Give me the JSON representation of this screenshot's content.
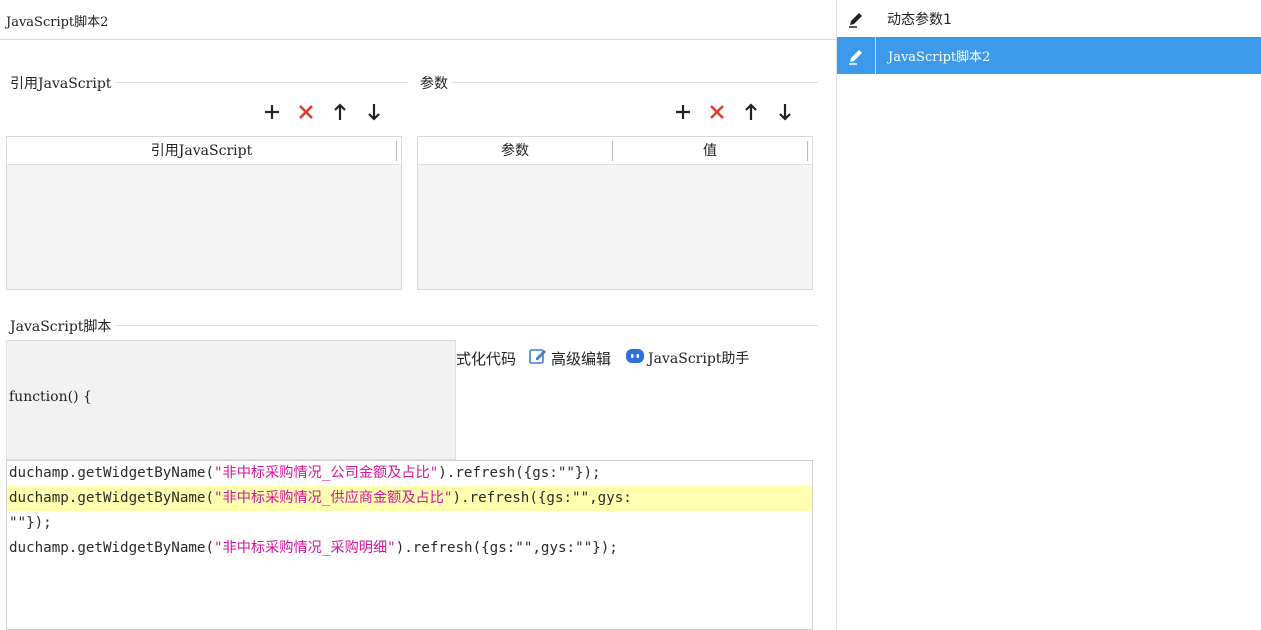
{
  "window": {
    "title": "JavaScript脚本2"
  },
  "ref_js": {
    "group_label": "引用JavaScript",
    "column_header": "引用JavaScript"
  },
  "params": {
    "group_label": "参数",
    "columns": [
      "参数",
      "值"
    ]
  },
  "toolbar_icons": [
    "add-icon",
    "delete-icon",
    "move-up-icon",
    "move-down-icon"
  ],
  "script": {
    "group_label": "JavaScript脚本",
    "function_header": "function() {",
    "actions": {
      "format_label": "式化代码",
      "advanced_edit_label": "高级编辑",
      "assistant_label": "JavaScript助手"
    },
    "code_lines": [
      {
        "prefix": "duchamp.getWidgetByName(",
        "string": "\"非中标采购情况_公司金额及占比\"",
        "suffix": ").refresh({gs:\"\"});",
        "highlight": false
      },
      {
        "prefix": "duchamp.getWidgetByName(",
        "string": "\"非中标采购情况_供应商金额及占比\"",
        "suffix": ").refresh({gs:\"\",gys:",
        "highlight": true
      },
      {
        "prefix": "\"\"});",
        "string": "",
        "suffix": "",
        "highlight": false
      },
      {
        "prefix": "duchamp.getWidgetByName(",
        "string": "\"非中标采购情况_采购明细\"",
        "suffix": ").refresh({gs:\"\",gys:\"\"});",
        "highlight": false
      }
    ]
  },
  "side_panel": {
    "items": [
      {
        "label": "动态参数1",
        "icon": "edit-icon",
        "active": false
      },
      {
        "label": "JavaScript脚本2",
        "icon": "edit-icon",
        "active": true
      }
    ]
  },
  "colors": {
    "accent": "#3c9aeb",
    "delete_red": "#e53935",
    "string_magenta": "#d6159a",
    "highlight_line": "#ffffb0"
  }
}
